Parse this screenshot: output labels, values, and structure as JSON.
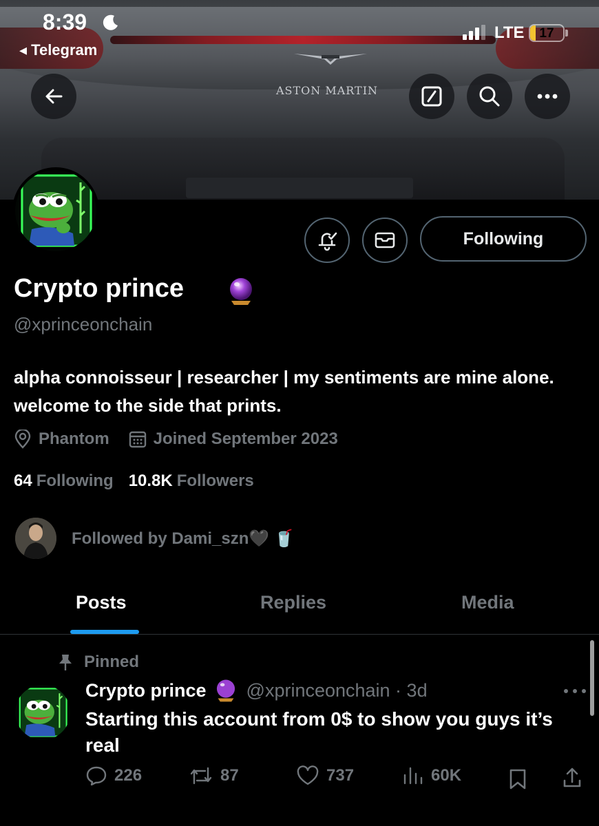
{
  "status_bar": {
    "time": "8:39",
    "back_app": "◂ Telegram",
    "network": "LTE",
    "battery": "17",
    "battery_level": 0.17
  },
  "banner": {
    "brand_text": "ASTON MARTIN"
  },
  "header_buttons": [
    "back-arrow-icon",
    "edit-icon",
    "search-icon",
    "more-icon"
  ],
  "profile": {
    "display_name": "Crypto prince",
    "handle": "@xprinceonchain",
    "bio": "alpha connoisseur | researcher | my sentiments are mine alone. welcome to the side that prints.",
    "location": "Phantom",
    "joined": "Joined September 2023",
    "following_count": "64",
    "following_label": "Following",
    "followers_count": "10.8K",
    "followers_label": "Followers",
    "followed_by": "Followed by Dami_szn🖤 🥤",
    "follow_button": "Following"
  },
  "tabs": [
    {
      "label": "Posts",
      "active": true
    },
    {
      "label": "Replies",
      "active": false
    },
    {
      "label": "Media",
      "active": false
    }
  ],
  "pinned_post": {
    "pinned_label": "Pinned",
    "name": "Crypto prince",
    "handle_time": "@xprinceonchain · 3d",
    "text": "Starting this account from 0$ to show you guys it’s real",
    "replies": "226",
    "reposts": "87",
    "likes": "737",
    "views": "60K"
  },
  "colors": {
    "accent": "#1d9bf0",
    "muted": "#71767b",
    "background": "#000000",
    "border": "#536471"
  }
}
